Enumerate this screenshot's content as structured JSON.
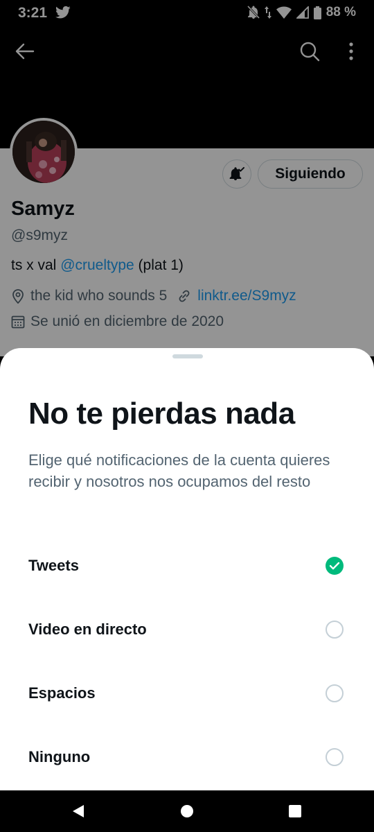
{
  "status": {
    "time": "3:21",
    "battery": "88 %"
  },
  "topbar": {
    "back_icon": "arrow-left-icon",
    "search_icon": "search-icon",
    "more_icon": "more-vertical-icon"
  },
  "profile": {
    "name": "Samyz",
    "handle": "@s9myz",
    "bio_prefix": "ts x val ",
    "bio_mention": "@crueltype",
    "bio_suffix": " (plat 1)",
    "location": "the kid who sounds 5",
    "link": "linktr.ee/S9myz",
    "joined": "Se unió en diciembre de 2020",
    "follow_button": "Siguiendo"
  },
  "sheet": {
    "title": "No te pierdas nada",
    "description": "Elige qué notificaciones de la cuenta quieres recibir y nosotros nos ocupamos del resto",
    "options": [
      {
        "label": "Tweets",
        "selected": true
      },
      {
        "label": "Video en directo",
        "selected": false
      },
      {
        "label": "Espacios",
        "selected": false
      },
      {
        "label": "Ninguno",
        "selected": false
      }
    ]
  },
  "colors": {
    "accent": "#1d9bf0",
    "check": "#00ba7c",
    "text": "#0f1419",
    "secondary": "#536471"
  }
}
